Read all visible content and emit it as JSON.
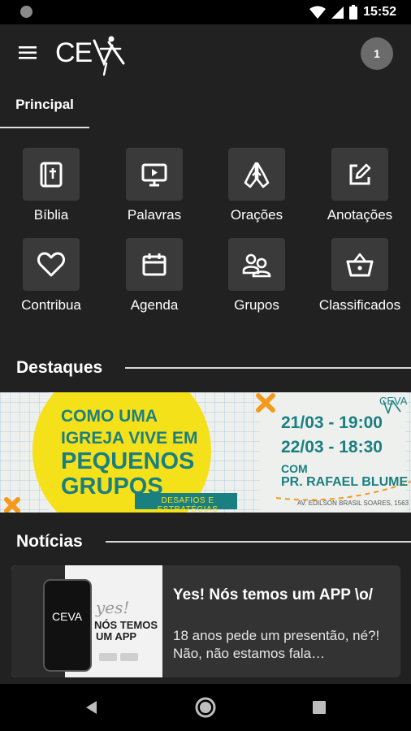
{
  "status": {
    "time": "15:52"
  },
  "app": {
    "logo_text": "CEVA",
    "avatar_label": "1"
  },
  "tabs": [
    {
      "label": "Principal"
    }
  ],
  "grid": [
    {
      "label": "Bíblia",
      "icon": "bible-icon"
    },
    {
      "label": "Palavras",
      "icon": "monitor-play-icon"
    },
    {
      "label": "Orações",
      "icon": "praying-hands-icon"
    },
    {
      "label": "Anotações",
      "icon": "edit-note-icon"
    },
    {
      "label": "Contribua",
      "icon": "heart-icon"
    },
    {
      "label": "Agenda",
      "icon": "calendar-icon"
    },
    {
      "label": "Grupos",
      "icon": "group-icon"
    },
    {
      "label": "Classificados",
      "icon": "basket-icon"
    }
  ],
  "sections": {
    "featured": "Destaques",
    "news": "Notícias"
  },
  "banner": {
    "headline": [
      "COMO UMA",
      "IGREJA VIVE EM",
      "PEQUENOS",
      "GRUPOS"
    ],
    "subtitle": "DESAFIOS E ESTRATÉGIAS",
    "date1": "21/03 - 19:00",
    "date2": "22/03 - 18:30",
    "with": "COM",
    "speaker": "PR. RAFAEL BLUME",
    "address": "AV. EDILSON BRASIL SOARES, 1563",
    "logo": "CEVA"
  },
  "news": [
    {
      "title": "Yes! Nós temos um APP \\o/",
      "excerpt": "18 anos pede um presentão, né?! Não, não estamos fala…",
      "thumb_logo": "CEVA",
      "thumb_text": [
        "yes!",
        "NÓS TEMOS",
        "UM APP"
      ]
    }
  ],
  "colors": {
    "background": "#212121",
    "tile": "#3a3a3a",
    "card": "#333333",
    "banner_yellow": "#f5e11a",
    "banner_teal": "#1a7f80",
    "banner_orange": "#f39a1c"
  }
}
